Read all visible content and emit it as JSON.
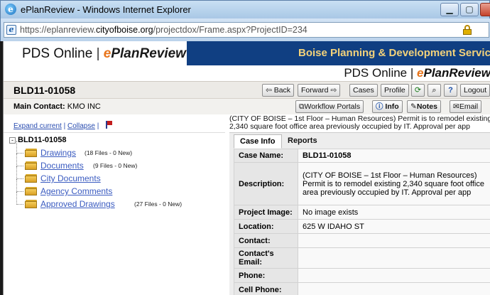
{
  "window": {
    "title": "ePlanReview - Windows Internet Explorer",
    "url_prefix": "https://eplanreview.",
    "url_domain": "cityofboise.org",
    "url_suffix": "/projectdox/Frame.aspx?ProjectID=234"
  },
  "header": {
    "brand_pds": "PDS Online",
    "brand_sep": "|",
    "brand_e": "e",
    "brand_rest": "PlanReview",
    "org_name": "Boise Planning & Development Services",
    "brand2_pds": "PDS Online",
    "brand2_sep": "|",
    "brand2_e": "e",
    "brand2_rest": "PlanReview"
  },
  "case": {
    "title": "BLD11-01058",
    "main_contact_label": "Main Contact:",
    "main_contact_value": "KMO INC",
    "desc_line1": "(CITY OF BOISE – 1st Floor – Human Resources) Permit is to remodel existing",
    "desc_line2": "2,340 square foot office area previously occupied by IT. Approval per app"
  },
  "toolbar": {
    "back": "⇦ Back",
    "forward": "Forward ⇨",
    "cases": "Cases",
    "profile": "Profile",
    "logout": "Logout",
    "workflow": "Workflow Portals",
    "info": "Info",
    "notes": "Notes",
    "email": "Email"
  },
  "tree": {
    "expand_current": "Expand current",
    "collapse": "Collapse",
    "sep": "|",
    "root": "BLD11-01058",
    "items": [
      {
        "label": "Drawings",
        "count": "(18 Files - 0 New)"
      },
      {
        "label": "Documents",
        "count": "(9 Files - 0 New)"
      },
      {
        "label": "City Documents",
        "count": ""
      },
      {
        "label": "Agency Comments",
        "count": ""
      },
      {
        "label": "Approved Drawings",
        "count": "(27 Files - 0 New)"
      }
    ]
  },
  "tabs": [
    "Case Info",
    "Reports"
  ],
  "case_info": {
    "rows": [
      {
        "k": "Case Name:",
        "v": "BLD11-01058"
      },
      {
        "k": "Description:",
        "v": "(CITY OF BOISE – 1st Floor – Human Resources) Permit is to remodel existing 2,340 square foot office area previously occupied by IT. Approval per app"
      },
      {
        "k": "Project Image:",
        "v": "No image exists"
      },
      {
        "k": "Location:",
        "v": "625 W IDAHO ST"
      },
      {
        "k": "Contact:",
        "v": ""
      },
      {
        "k": "Contact's Email:",
        "v": ""
      },
      {
        "k": "Phone:",
        "v": ""
      },
      {
        "k": "Cell Phone:",
        "v": ""
      }
    ]
  }
}
